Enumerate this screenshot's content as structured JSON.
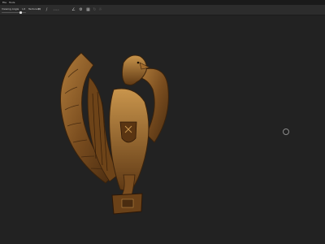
{
  "menubar": {
    "items": [
      "File",
      "Tools"
    ]
  },
  "toolbar": {
    "labels": [
      "Viewing Angle",
      "Lit",
      "Textured"
    ],
    "slider_value": 0.8,
    "icons": [
      "crop-icon",
      "brush-icon",
      "list-icon",
      "angle-icon",
      "gear-icon",
      "grid-icon",
      "rotate-icon",
      "sun-icon"
    ]
  },
  "colors": {
    "background": "#222222",
    "toolbar": "#2c2c2c",
    "bronze": "#8a5a26",
    "bronze_highlight": "#c9954c"
  }
}
